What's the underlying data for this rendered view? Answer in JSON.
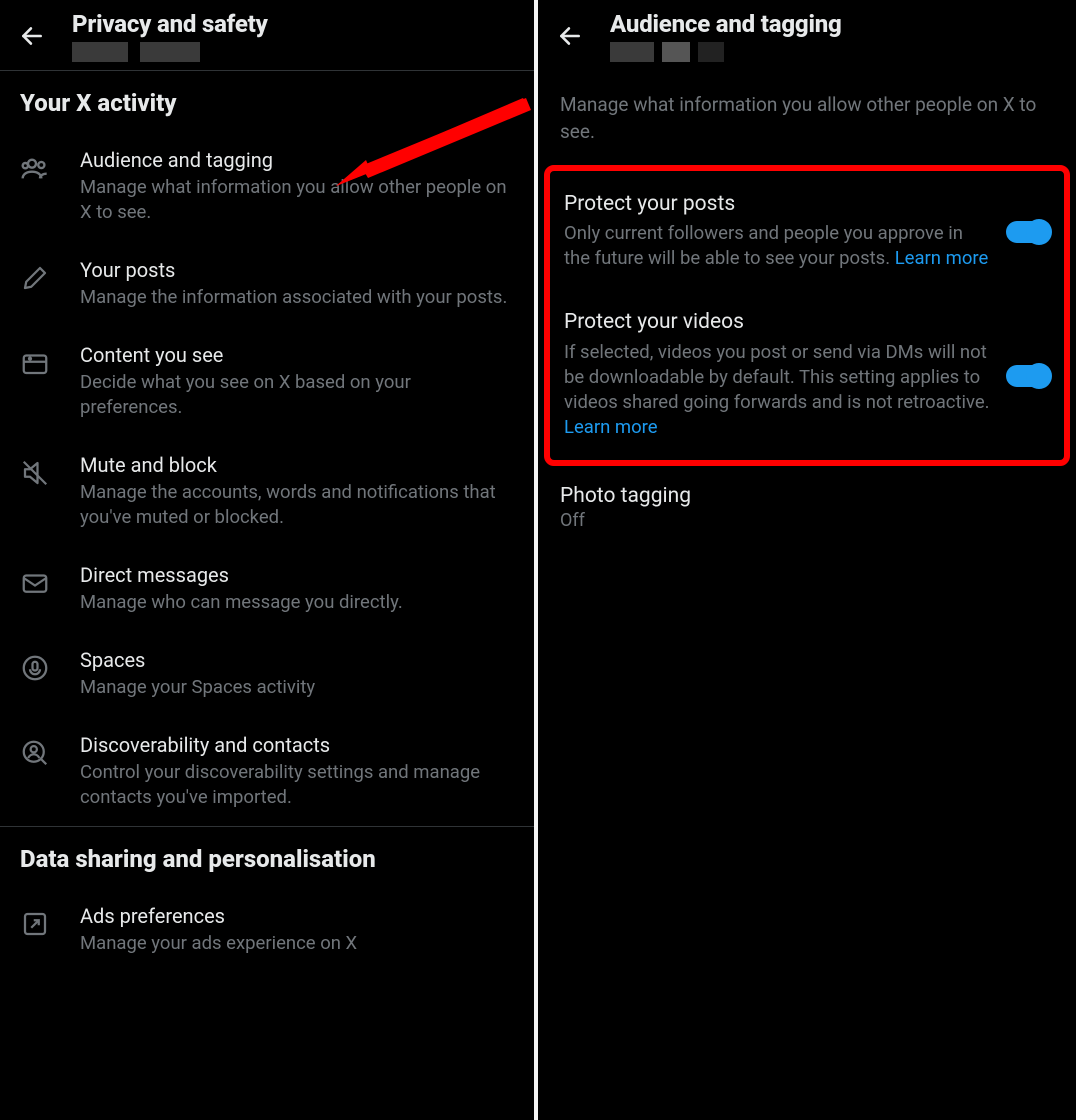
{
  "left": {
    "title": "Privacy and safety",
    "section1": "Your X activity",
    "items": [
      {
        "title": "Audience and tagging",
        "desc": "Manage what information you allow other people on X to see."
      },
      {
        "title": "Your posts",
        "desc": "Manage the information associated with your posts."
      },
      {
        "title": "Content you see",
        "desc": "Decide what you see on X based on your preferences."
      },
      {
        "title": "Mute and block",
        "desc": "Manage the accounts, words and notifications that you've muted or blocked."
      },
      {
        "title": "Direct messages",
        "desc": "Manage who can message you directly."
      },
      {
        "title": "Spaces",
        "desc": "Manage your Spaces activity"
      },
      {
        "title": "Discoverability and contacts",
        "desc": "Control your discoverability settings and manage contacts you've imported."
      }
    ],
    "section2": "Data sharing and personalisation",
    "ads": {
      "title": "Ads preferences",
      "desc": "Manage your ads experience on X"
    }
  },
  "right": {
    "title": "Audience and tagging",
    "desc": "Manage what information you allow other people on X to see.",
    "protect_posts": {
      "title": "Protect your posts",
      "desc": "Only current followers and people you approve in the future will be able to see your posts. ",
      "link": "Learn more"
    },
    "protect_videos": {
      "title": "Protect your videos",
      "desc": "If selected, videos you post or send via DMs will not be downloadable by default. This setting applies to videos shared going forwards and is not retroactive. ",
      "link": "Learn more"
    },
    "photo_tagging": {
      "title": "Photo tagging",
      "value": "Off"
    }
  }
}
